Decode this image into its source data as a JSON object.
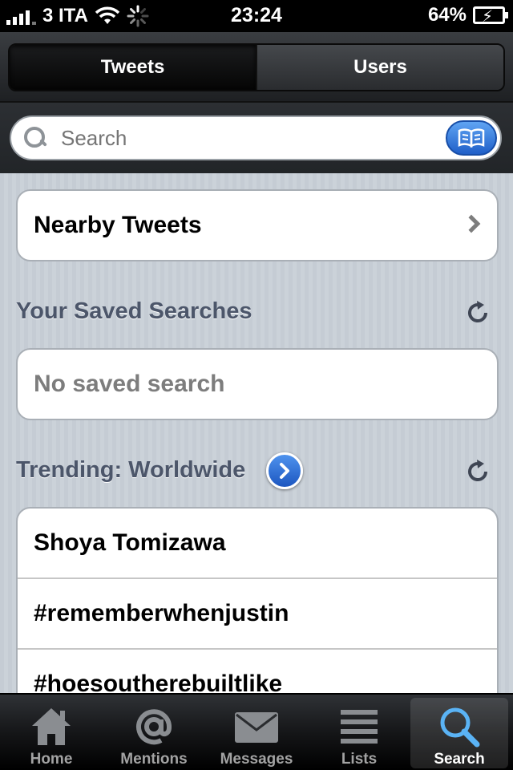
{
  "status_bar": {
    "carrier": "3 ITA",
    "time": "23:24",
    "battery": "64%",
    "icons": [
      "signal-icon",
      "wifi-icon",
      "activity-spinner-icon",
      "battery-charging-icon"
    ]
  },
  "segmented": {
    "tweets_label": "Tweets",
    "users_label": "Users",
    "selected": "Tweets"
  },
  "search": {
    "placeholder": "Search",
    "value": ""
  },
  "nearby": {
    "label": "Nearby Tweets"
  },
  "saved_searches": {
    "title": "Your Saved Searches",
    "empty_text": "No saved search"
  },
  "trending": {
    "title": "Trending: Worldwide",
    "items": [
      "Shoya Tomizawa",
      "#rememberwhenjustin",
      "#hoesoutherebuiltlike"
    ]
  },
  "tabbar": {
    "items": [
      {
        "label": "Home",
        "icon": "home-icon"
      },
      {
        "label": "Mentions",
        "icon": "at-icon"
      },
      {
        "label": "Messages",
        "icon": "envelope-icon"
      },
      {
        "label": "Lists",
        "icon": "list-icon"
      },
      {
        "label": "Search",
        "icon": "search-icon"
      }
    ],
    "active": "Search"
  },
  "colors": {
    "accent_blue": "#2a6fd9",
    "section_title": "#4c566a",
    "tab_active": "#5ab3f5"
  }
}
